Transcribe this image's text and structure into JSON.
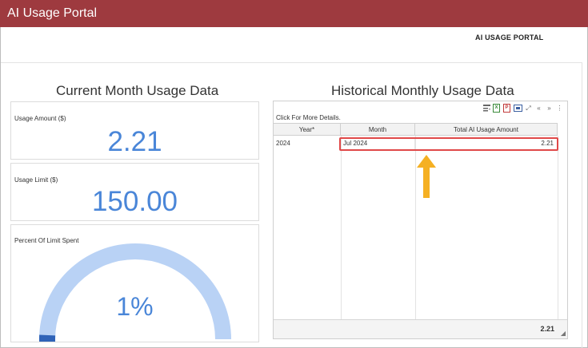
{
  "app": {
    "title": "AI Usage Portal",
    "portal_label": "AI USAGE PORTAL"
  },
  "current": {
    "title": "Current Month Usage Data",
    "usage_amount": {
      "label": "Usage Amount ($)",
      "value": "2.21"
    },
    "usage_limit": {
      "label": "Usage Limit ($)",
      "value": "150.00"
    },
    "percent": {
      "label": "Percent Of Limit Spent",
      "value": "1%",
      "fraction": 0.0147
    }
  },
  "historical": {
    "title": "Historical Monthly Usage Data",
    "click_details": "Click For More Details.",
    "columns": [
      "Year*",
      "Month",
      "Total AI Usage Amount"
    ],
    "rows": [
      {
        "year": "2024",
        "month": "Jul 2024",
        "amount": "2.21"
      }
    ],
    "footer_total": "2.21",
    "toolbar_icons": [
      "filter-icon",
      "excel-export-icon",
      "pdf-export-icon",
      "column-chooser-icon",
      "fullscreen-icon",
      "prev-page-icon",
      "next-page-icon",
      "more-options-icon"
    ]
  },
  "colors": {
    "header": "#9e3a3f",
    "kpi_value": "#4a86d8",
    "gauge_track": "#b9d2f5",
    "gauge_fill": "#2f63b8",
    "highlight": "#e04848",
    "arrow": "#f5b023"
  }
}
